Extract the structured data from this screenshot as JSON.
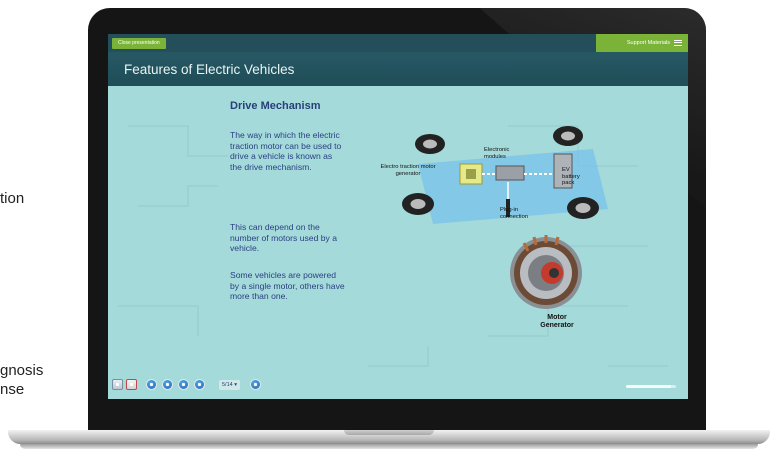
{
  "background_text": {
    "line1": "tion",
    "line2": "gnosis",
    "line3": "nse"
  },
  "presentation": {
    "close_label": "Close presentation",
    "support_label": "Support Materials",
    "title": "Features of Electric Vehicles"
  },
  "content": {
    "heading": "Drive Mechanism",
    "paragraph1": "The way in which the electric traction motor can be used to drive a vehicle is known as the drive mechanism.",
    "paragraph2": "This can depend on the number of motors used by a vehicle.",
    "paragraph3": "Some vehicles are powered by a single motor, others have more than one."
  },
  "diagram": {
    "label_motor": "Electro traction motor generator",
    "label_modules": "Electronic modules",
    "label_battery": "EV battery pack",
    "label_plugin": "Plug-in connection",
    "motor_caption_1": "Motor",
    "motor_caption_2": "Generator"
  },
  "toolbar": {
    "page_indicator": "5/14 ▾",
    "progress_fraction": 0.9,
    "buttons": [
      "print-icon",
      "home-icon",
      "first-page-icon",
      "previous-section-icon",
      "previous-page-icon",
      "back-icon",
      "next-page-icon"
    ]
  },
  "colors": {
    "screen_bg": "#a5dadb",
    "header_bg": "#244f5a",
    "accent_green": "#7ab337",
    "text_blue": "#2a3f80"
  }
}
